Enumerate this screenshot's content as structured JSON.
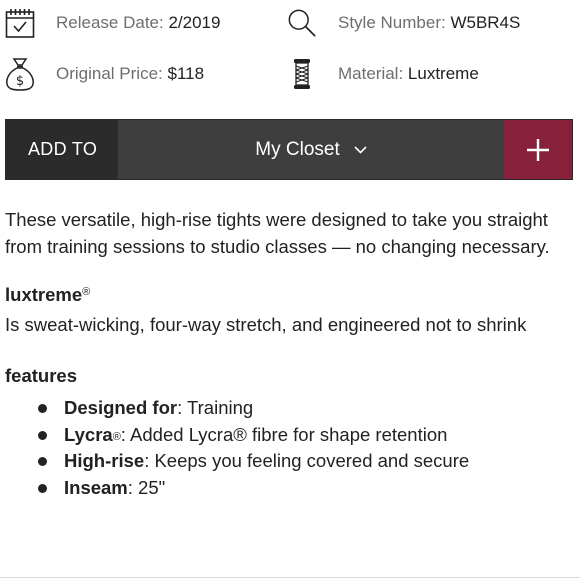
{
  "meta": {
    "release": {
      "label": "Release Date: ",
      "value": "2/2019"
    },
    "style": {
      "label": "Style Number: ",
      "value": "W5BR4S"
    },
    "price": {
      "label": "Original Price: ",
      "value": "$118"
    },
    "material": {
      "label": "Material: ",
      "value": "Luxtreme"
    }
  },
  "addbar": {
    "add_to": "ADD TO",
    "closet": "My Closet"
  },
  "description": "These versatile, high-rise tights were designed to take you straight from training sessions to studio classes — no changing necessary.",
  "luxtreme": {
    "heading": "luxtreme",
    "registered": "®",
    "text": "Is sweat-wicking, four-way stretch, and engineered not to shrink"
  },
  "features": {
    "heading": "features",
    "items": [
      {
        "bold": "Designed for",
        "rest": ": Training"
      },
      {
        "bold": "Lycra",
        "mark": "®",
        "rest": ": Added Lycra® fibre for shape retention"
      },
      {
        "bold": "High-rise",
        "rest": ": Keeps you feeling covered and secure"
      },
      {
        "bold": "Inseam",
        "rest": ": 25\""
      }
    ]
  },
  "colors": {
    "dark_bar": "#3e3e3e",
    "add_to_bg": "#2b2b2b",
    "accent": "#87213b"
  },
  "icons": [
    "calendar-icon",
    "search-icon",
    "money-bag-icon",
    "thread-spool-icon",
    "chevron-down-icon",
    "plus-icon"
  ]
}
